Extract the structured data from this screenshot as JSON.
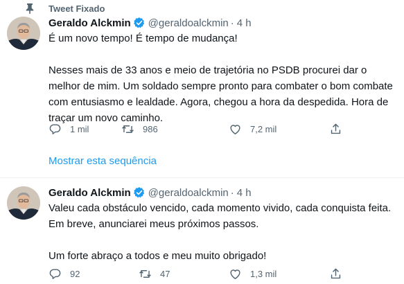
{
  "pinned": {
    "label": "Tweet Fixado"
  },
  "thread_link": "Mostrar esta sequência",
  "tweets": [
    {
      "author": {
        "name": "Geraldo Alckmin",
        "handle": "@geraldoalckmin",
        "verified": true
      },
      "separator": "·",
      "time": "4 h",
      "paragraphs": [
        "É um novo tempo! É tempo de mudança!",
        "Nesses mais de 33 anos e meio de trajetória no PSDB procurei dar o melhor de mim. Um soldado sempre pronto para combater o bom combate com entusiasmo e lealdade. Agora, chegou a hora da despedida. Hora de traçar um novo caminho."
      ],
      "actions": {
        "replies": "1 mil",
        "retweets": "986",
        "likes": "7,2 mil"
      }
    },
    {
      "author": {
        "name": "Geraldo Alckmin",
        "handle": "@geraldoalckmin",
        "verified": true
      },
      "separator": "·",
      "time": "4 h",
      "paragraphs": [
        "Valeu cada obstáculo vencido, cada momento vivido, cada conquista feita. Em breve, anunciarei meus próximos passos.",
        "Um forte abraço a todos e meu muito obrigado!"
      ],
      "actions": {
        "replies": "92",
        "retweets": "47",
        "likes": "1,3 mil"
      }
    }
  ],
  "colors": {
    "text": "#0f1419",
    "secondary": "#536471",
    "link": "#1d9bf0",
    "verified_badge": "#1d9bf0",
    "divider": "#eff3f4"
  },
  "icons": [
    "pin-icon",
    "verified-badge-icon",
    "reply-icon",
    "retweet-icon",
    "like-icon",
    "share-icon"
  ]
}
